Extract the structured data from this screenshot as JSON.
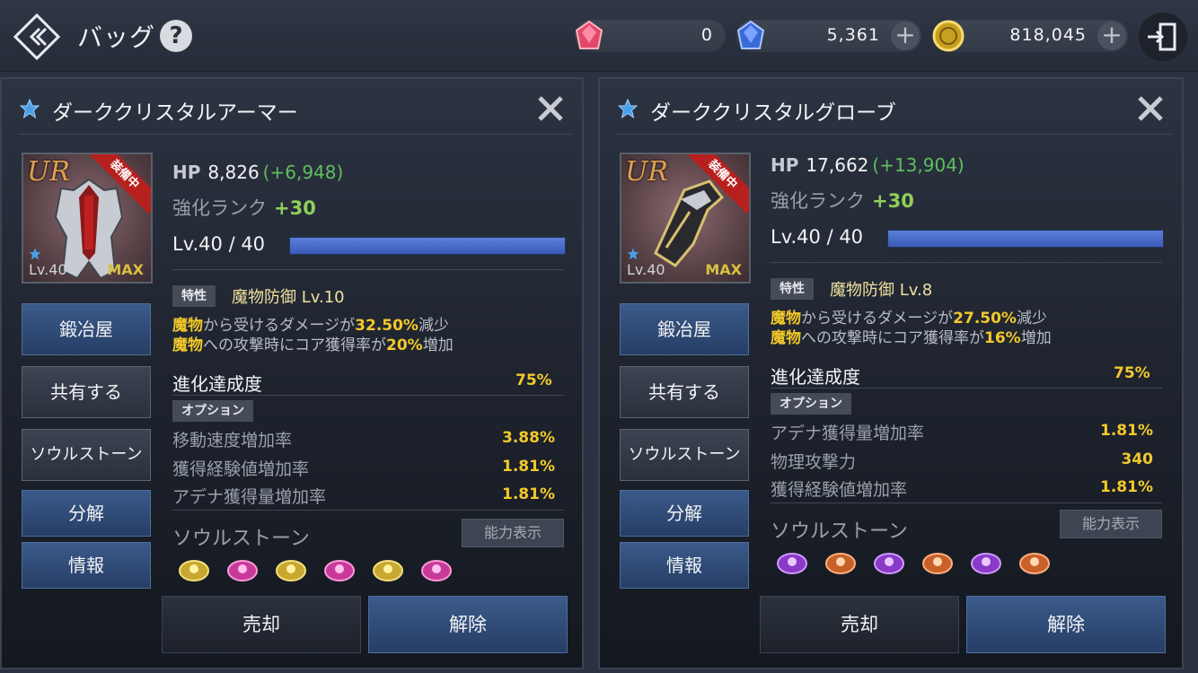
{
  "header": {
    "title": "バッグ",
    "help": "?",
    "currencies": [
      {
        "icon": "red-crystal-icon",
        "amount": "0"
      },
      {
        "icon": "blue-crystal-icon",
        "amount": "5,361"
      },
      {
        "icon": "gold-coin-icon",
        "amount": "818,045"
      }
    ],
    "plus": "+"
  },
  "panels": [
    {
      "name": "ダーククリスタルアーマー",
      "rarity": "UR",
      "equipped": "装備中",
      "portrait_level": "Lv.40",
      "portrait_max": "MAX",
      "hp_label": "HP",
      "hp_value": "8,826",
      "hp_bonus": "(+6,948)",
      "rank_label": "強化ランク",
      "rank_value": "+30",
      "level": "Lv.40 / 40",
      "level_fill": 1.0,
      "trait_tag": "特性",
      "trait_name": "魔物防御 Lv.10",
      "trait_line1": {
        "a": "魔物",
        "b": "から受けるダメージが",
        "c": "32.50%",
        "d": "減少"
      },
      "trait_line2": {
        "a": "魔物",
        "b": "への攻撃時にコア獲得率が",
        "c": "20%",
        "d": "増加"
      },
      "evo_label": "進化達成度",
      "evo_value": "75%",
      "option_tag": "オプション",
      "options": [
        {
          "label": "移動速度増加率",
          "value": "3.88%"
        },
        {
          "label": "獲得経験値増加率",
          "value": "1.81%"
        },
        {
          "label": "アデナ獲得量増加率",
          "value": "1.81%"
        }
      ],
      "soul_title": "ソウルストーン",
      "ability_btn": "能力表示",
      "stones": [
        "gold",
        "pink",
        "gold",
        "pink",
        "gold",
        "pink"
      ],
      "side_buttons": [
        "鍛冶屋",
        "共有する",
        "ソウルストーン",
        "分解",
        "情報"
      ],
      "sell": "売却",
      "unequip": "解除"
    },
    {
      "name": "ダーククリスタルグローブ",
      "rarity": "UR",
      "equipped": "装備中",
      "portrait_level": "Lv.40",
      "portrait_max": "MAX",
      "hp_label": "HP",
      "hp_value": "17,662",
      "hp_bonus": "(+13,904)",
      "rank_label": "強化ランク",
      "rank_value": "+30",
      "level": "Lv.40 / 40",
      "level_fill": 1.0,
      "trait_tag": "特性",
      "trait_name": "魔物防御 Lv.8",
      "trait_line1": {
        "a": "魔物",
        "b": "から受けるダメージが",
        "c": "27.50%",
        "d": "減少"
      },
      "trait_line2": {
        "a": "魔物",
        "b": "への攻撃時にコア獲得率が",
        "c": "16%",
        "d": "増加"
      },
      "evo_label": "進化達成度",
      "evo_value": "75%",
      "option_tag": "オプション",
      "options": [
        {
          "label": "アデナ獲得量増加率",
          "value": "1.81%"
        },
        {
          "label": "物理攻撃力",
          "value": "340"
        },
        {
          "label": "獲得経験値増加率",
          "value": "1.81%"
        }
      ],
      "soul_title": "ソウルストーン",
      "ability_btn": "能力表示",
      "stones": [
        "purple",
        "orange",
        "purple",
        "orange",
        "purple",
        "orange"
      ],
      "side_buttons": [
        "鍛冶屋",
        "共有する",
        "ソウルストーン",
        "分解",
        "情報"
      ],
      "sell": "売却",
      "unequip": "解除"
    }
  ],
  "colors": {
    "accent_gold": "#f3c92a",
    "hp_bonus": "#5fbf5f",
    "rank_green": "#8fcf5a",
    "button_blue": "#3b5a8a"
  }
}
